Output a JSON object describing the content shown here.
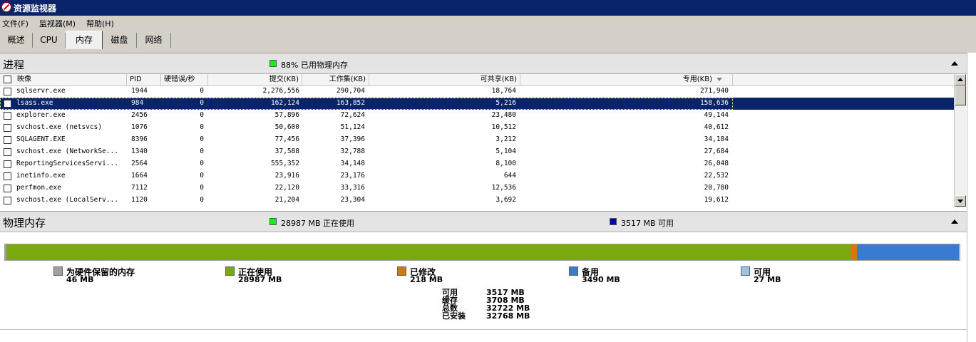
{
  "window": {
    "title": "资源监视器"
  },
  "menu": [
    "文件(F)",
    "监视器(M)",
    "帮助(H)"
  ],
  "tabs": [
    "概述",
    "CPU",
    "内存",
    "磁盘",
    "网络"
  ],
  "active_tab": "内存",
  "process_section": {
    "title": "进程",
    "legend_text": "88% 已用物理内存",
    "legend_color": "#00ff00",
    "columns": [
      "映像",
      "PID",
      "硬错误/秒",
      "提交(KB)",
      "工作集(KB)",
      "可共享(KB)",
      "专用(KB)"
    ],
    "rows": [
      {
        "image": "sqlservr.exe",
        "pid": "1944",
        "hardfaults": "0",
        "commit": "2,276,556",
        "workingset": "290,704",
        "shareable": "18,764",
        "private": "271,940",
        "selected": false
      },
      {
        "image": "lsass.exe",
        "pid": "984",
        "hardfaults": "0",
        "commit": "162,124",
        "workingset": "163,852",
        "shareable": "5,216",
        "private": "158,636",
        "selected": true
      },
      {
        "image": "explorer.exe",
        "pid": "2456",
        "hardfaults": "0",
        "commit": "57,896",
        "workingset": "72,624",
        "shareable": "23,480",
        "private": "49,144",
        "selected": false
      },
      {
        "image": "svchost.exe (netsvcs)",
        "pid": "1076",
        "hardfaults": "0",
        "commit": "50,600",
        "workingset": "51,124",
        "shareable": "10,512",
        "private": "40,612",
        "selected": false
      },
      {
        "image": "SQLAGENT.EXE",
        "pid": "8396",
        "hardfaults": "0",
        "commit": "77,456",
        "workingset": "37,396",
        "shareable": "3,212",
        "private": "34,184",
        "selected": false
      },
      {
        "image": "svchost.exe (NetworkSe...",
        "pid": "1340",
        "hardfaults": "0",
        "commit": "37,588",
        "workingset": "32,788",
        "shareable": "5,104",
        "private": "27,684",
        "selected": false
      },
      {
        "image": "ReportingServicesServi...",
        "pid": "2564",
        "hardfaults": "0",
        "commit": "555,352",
        "workingset": "34,148",
        "shareable": "8,100",
        "private": "26,048",
        "selected": false
      },
      {
        "image": "inetinfo.exe",
        "pid": "1664",
        "hardfaults": "0",
        "commit": "23,916",
        "workingset": "23,176",
        "shareable": "644",
        "private": "22,532",
        "selected": false
      },
      {
        "image": "perfmon.exe",
        "pid": "7112",
        "hardfaults": "0",
        "commit": "22,120",
        "workingset": "33,316",
        "shareable": "12,536",
        "private": "20,780",
        "selected": false
      },
      {
        "image": "svchost.exe (LocalServ...",
        "pid": "1120",
        "hardfaults": "0",
        "commit": "21,204",
        "workingset": "23,304",
        "shareable": "3,692",
        "private": "19,612",
        "selected": false
      }
    ]
  },
  "physical_section": {
    "title": "物理内存",
    "in_use_text": "28987 MB 正在使用",
    "in_use_color": "#00ff00",
    "available_text": "3517 MB 可用",
    "available_color": "#0000c0",
    "bar": [
      {
        "name": "为硬件保留的内存",
        "value_mb": 46,
        "color": "#a0a0a0"
      },
      {
        "name": "正在使用",
        "value_mb": 28987,
        "color": "#7ba80e"
      },
      {
        "name": "已修改",
        "value_mb": 218,
        "color": "#d2780e"
      },
      {
        "name": "备用",
        "value_mb": 3490,
        "color": "#3a7bd2"
      },
      {
        "name": "可用",
        "value_mb": 27,
        "color": "#9cc3e8"
      }
    ],
    "legend": [
      {
        "label": "为硬件保留的内存",
        "value": "46 MB",
        "color": "#a0a0a0"
      },
      {
        "label": "正在使用",
        "value": "28987 MB",
        "color": "#7ba80e"
      },
      {
        "label": "已修改",
        "value": "218 MB",
        "color": "#d2780e"
      },
      {
        "label": "备用",
        "value": "3490 MB",
        "color": "#3a7bd2"
      },
      {
        "label": "可用",
        "value": "27 MB",
        "color": "#9cc3e8"
      }
    ],
    "stats": [
      {
        "label": "可用",
        "value": "3517 MB"
      },
      {
        "label": "缓存",
        "value": "3708 MB"
      },
      {
        "label": "总数",
        "value": "32722 MB"
      },
      {
        "label": "已安装",
        "value": "32768 MB"
      }
    ]
  }
}
